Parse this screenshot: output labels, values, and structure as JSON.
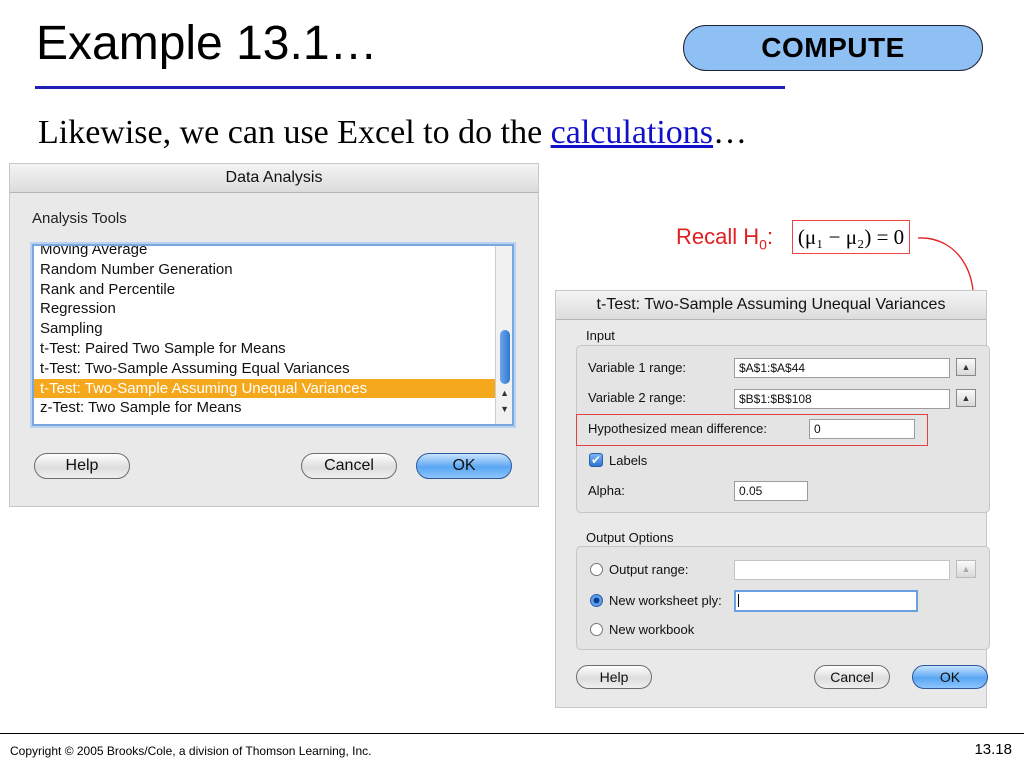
{
  "slide": {
    "title": "Example 13.1…",
    "badge": "COMPUTE",
    "subtitle_prefix": "Likewise, we can use Excel to do the ",
    "subtitle_link": "calculations",
    "subtitle_suffix": "…",
    "footer": "Copyright © 2005 Brooks/Cole, a division of Thomson Learning, Inc.",
    "page_number": "13.18"
  },
  "annotation": {
    "recall_prefix": "Recall H",
    "recall_sub": "0",
    "recall_colon": ":",
    "formula": "(μ₁ − μ₂) = 0",
    "colors": {
      "annotation": "#e02020"
    }
  },
  "data_analysis": {
    "title": "Data Analysis",
    "tools_label": "Analysis Tools",
    "items": [
      "Moving Average",
      "Random Number Generation",
      "Rank and Percentile",
      "Regression",
      "Sampling",
      "t-Test: Paired Two Sample for Means",
      "t-Test: Two-Sample Assuming Equal Variances",
      "t-Test: Two-Sample Assuming Unequal Variances",
      "z-Test: Two Sample for Means"
    ],
    "selected_item": "t-Test: Two-Sample Assuming Unequal Variances",
    "help": "Help",
    "cancel": "Cancel",
    "ok": "OK"
  },
  "ttest": {
    "title": "t-Test: Two-Sample Assuming Unequal Variances",
    "input_label": "Input",
    "var1_label": "Variable 1 range:",
    "var1_value": "$A$1:$A$44",
    "var2_label": "Variable 2 range:",
    "var2_value": "$B$1:$B$108",
    "hyp_label": "Hypothesized mean difference:",
    "hyp_value": "0",
    "labels_label": "Labels",
    "labels_checked": true,
    "alpha_label": "Alpha:",
    "alpha_value": "0.05",
    "output_label": "Output Options",
    "output_range_label": "Output range:",
    "output_range_value": "",
    "new_ply_label": "New worksheet ply:",
    "new_ply_value": "",
    "new_workbook_label": "New workbook",
    "selected_output": "New worksheet ply",
    "help": "Help",
    "cancel": "Cancel",
    "ok": "OK"
  },
  "colors": {
    "accent_rule": "#1f1fb5",
    "badge": "#8ec0f4",
    "selection": "#f6a81c",
    "default_button": "#5aa6f2"
  }
}
